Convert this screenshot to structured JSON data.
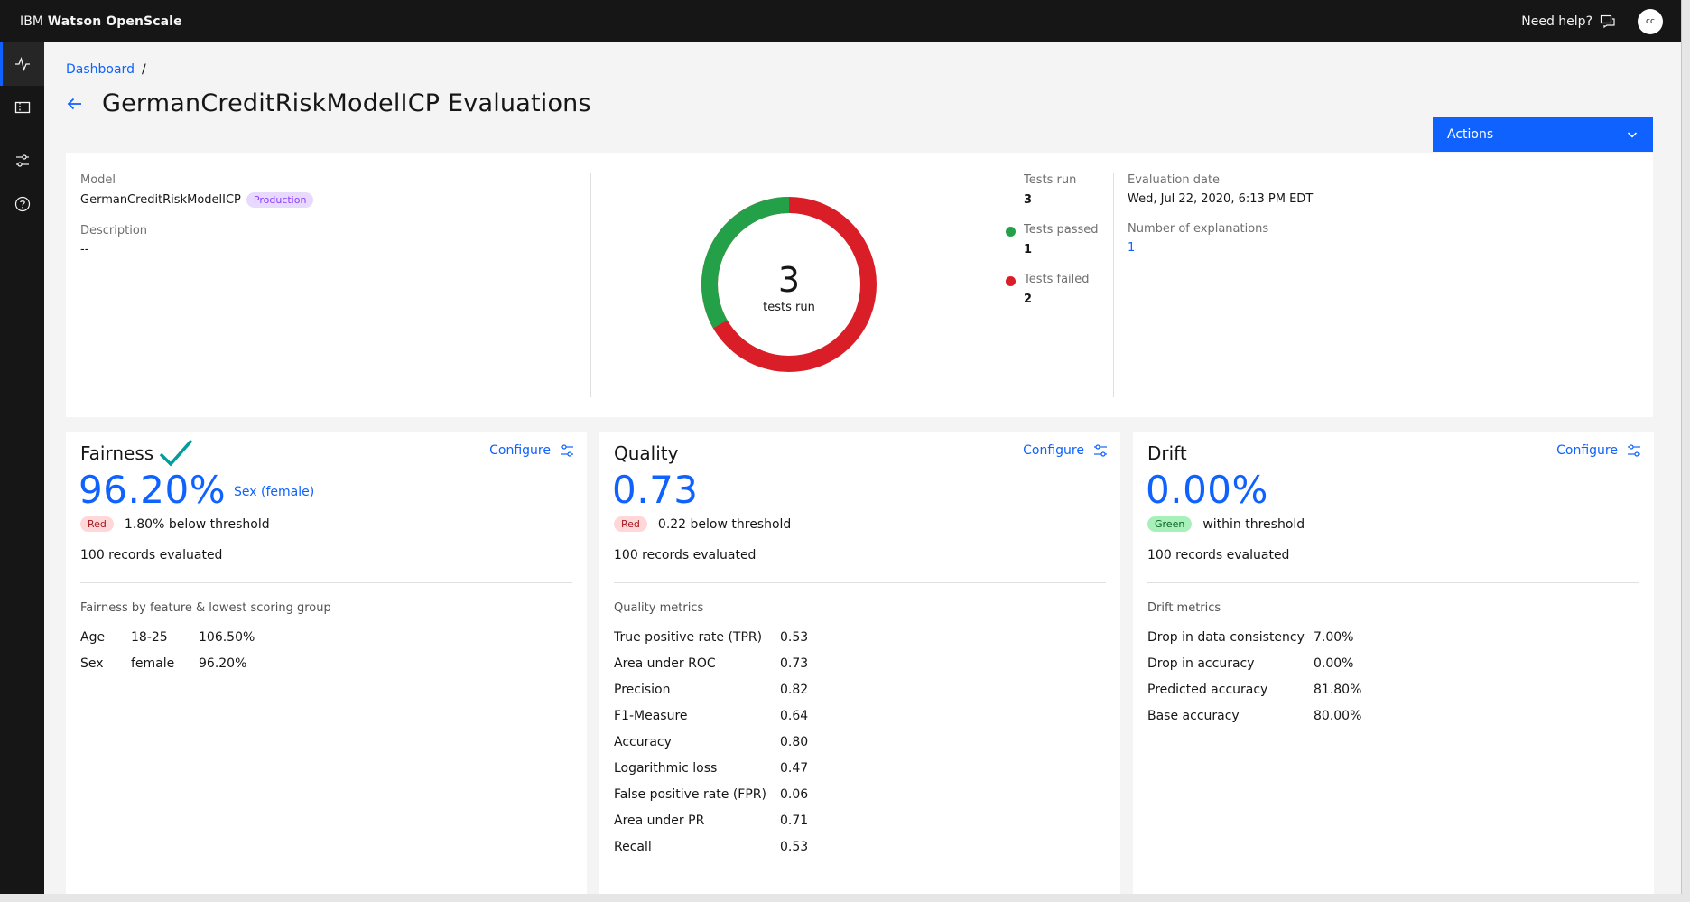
{
  "header": {
    "brand_ibm": "IBM",
    "brand_product": "Watson OpenScale",
    "need_help": "Need help?",
    "avatar_initials": "cc"
  },
  "sidebar": {
    "items": [
      {
        "icon": "activity-icon"
      },
      {
        "icon": "ticket-icon"
      },
      {
        "icon": "settings-sliders-icon"
      },
      {
        "icon": "help-icon"
      }
    ]
  },
  "breadcrumb": {
    "dashboard": "Dashboard",
    "separator": "/"
  },
  "page": {
    "title": "GermanCreditRiskModelICP Evaluations"
  },
  "actions": {
    "label": "Actions"
  },
  "summary": {
    "model_label": "Model",
    "model_value": "GermanCreditRiskModelICP",
    "model_tag": "Production",
    "description_label": "Description",
    "description_value": "--",
    "donut": {
      "total": "3",
      "caption": "tests run",
      "passed": 1,
      "failed": 2,
      "passed_color": "#24a148",
      "failed_color": "#da1e28"
    },
    "tests_run_label": "Tests run",
    "tests_run_value": "3",
    "tests_passed_label": "Tests passed",
    "tests_passed_value": "1",
    "tests_failed_label": "Tests failed",
    "tests_failed_value": "2",
    "eval_date_label": "Evaluation date",
    "eval_date_value": "Wed, Jul 22, 2020, 6:13 PM EDT",
    "explanations_label": "Number of explanations",
    "explanations_value": "1"
  },
  "fairness": {
    "title": "Fairness",
    "configure": "Configure",
    "value": "96.20%",
    "feature": "Sex (female)",
    "status_tag": "Red",
    "status_text": "1.80% below threshold",
    "records": "100 records evaluated",
    "section_label": "Fairness by feature & lowest scoring group",
    "rows": [
      {
        "feature": "Age",
        "group": "18-25",
        "score": "106.50%"
      },
      {
        "feature": "Sex",
        "group": "female",
        "score": "96.20%"
      }
    ]
  },
  "quality": {
    "title": "Quality",
    "configure": "Configure",
    "value": "0.73",
    "status_tag": "Red",
    "status_text": "0.22 below threshold",
    "records": "100 records evaluated",
    "section_label": "Quality metrics",
    "rows": [
      {
        "name": "True positive rate (TPR)",
        "value": "0.53"
      },
      {
        "name": "Area under ROC",
        "value": "0.73"
      },
      {
        "name": "Precision",
        "value": "0.82"
      },
      {
        "name": "F1-Measure",
        "value": "0.64"
      },
      {
        "name": "Accuracy",
        "value": "0.80"
      },
      {
        "name": "Logarithmic loss",
        "value": "0.47"
      },
      {
        "name": "False positive rate (FPR)",
        "value": "0.06"
      },
      {
        "name": "Area under PR",
        "value": "0.71"
      },
      {
        "name": "Recall",
        "value": "0.53"
      }
    ]
  },
  "drift": {
    "title": "Drift",
    "configure": "Configure",
    "value": "0.00%",
    "status_tag": "Green",
    "status_text": "within threshold",
    "records": "100 records evaluated",
    "section_label": "Drift metrics",
    "rows": [
      {
        "name": "Drop in data consistency",
        "value": "7.00%"
      },
      {
        "name": "Drop in accuracy",
        "value": "0.00%"
      },
      {
        "name": "Predicted accuracy",
        "value": "81.80%"
      },
      {
        "name": "Base accuracy",
        "value": "80.00%"
      }
    ]
  },
  "colors": {
    "accent": "#0f62fe",
    "header_bg": "#161616",
    "check": "#009d9a"
  }
}
